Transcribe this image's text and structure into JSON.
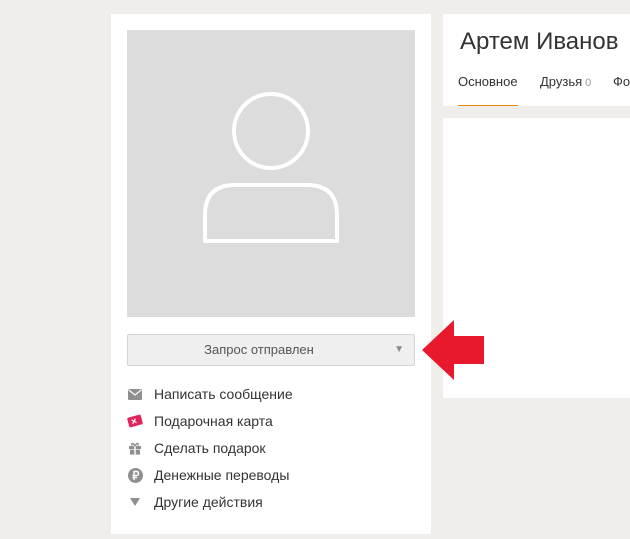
{
  "profile": {
    "name": "Артем Иванов",
    "friend_request_button": "Запрос отправлен",
    "tabs": [
      {
        "label": "Основное",
        "count": ""
      },
      {
        "label": "Друзья",
        "count": "0"
      },
      {
        "label": "Фо",
        "count": ""
      }
    ]
  },
  "actions": [
    {
      "label": "Написать сообщение",
      "icon": "envelope-icon"
    },
    {
      "label": "Подарочная карта",
      "icon": "gift-card-icon"
    },
    {
      "label": "Сделать подарок",
      "icon": "gift-icon"
    },
    {
      "label": "Денежные переводы",
      "icon": "ruble-icon"
    },
    {
      "label": "Другие действия",
      "icon": "triangle-down-icon"
    }
  ],
  "colors": {
    "accent": "#ee8208",
    "arrow": "#e8192c",
    "page_bg": "#f0eeea",
    "avatar_bg": "#dcdcdc"
  }
}
